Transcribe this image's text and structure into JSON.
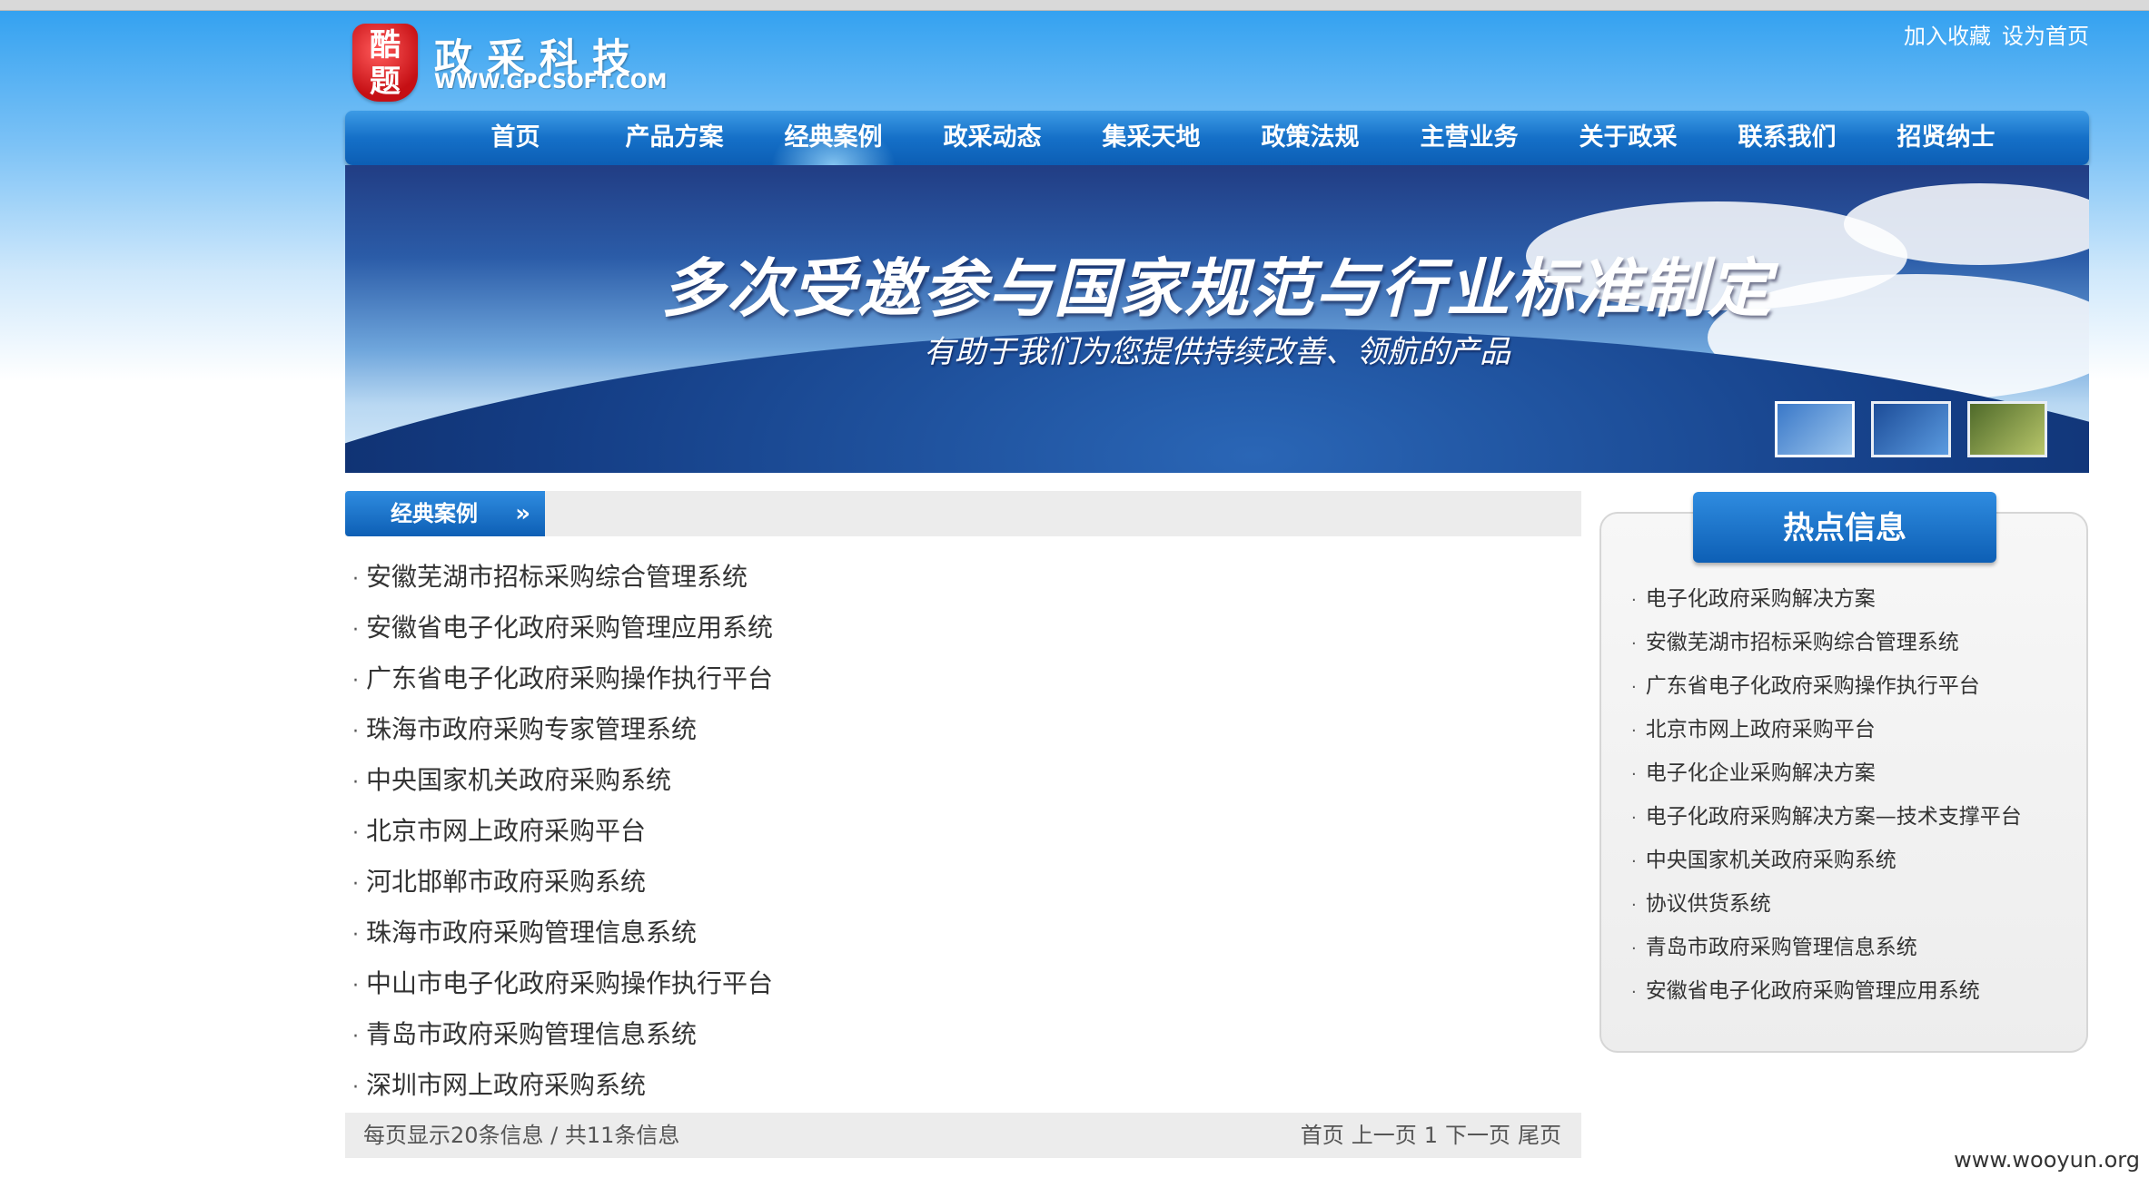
{
  "header": {
    "logo_seal_text": "酷\n题",
    "logo_name": "政采科技",
    "logo_url": "WWW.GPCSOFT.COM",
    "top_links": [
      "加入收藏",
      "设为首页"
    ]
  },
  "nav": {
    "items": [
      "首页",
      "产品方案",
      "经典案例",
      "政采动态",
      "集采天地",
      "政策法规",
      "主营业务",
      "关于政采",
      "联系我们",
      "招贤纳士"
    ],
    "active": "经典案例"
  },
  "banner": {
    "title": "多次受邀参与国家规范与行业标准制定",
    "subtitle": "有助于我们为您提供持续改善、领航的产品"
  },
  "section": {
    "tab_label": "经典案例",
    "tab_chevron": "»"
  },
  "cases": [
    "安徽芜湖市招标采购综合管理系统",
    "安徽省电子化政府采购管理应用系统",
    "广东省电子化政府采购操作执行平台",
    "珠海市政府采购专家管理系统",
    "中央国家机关政府采购系统",
    "北京市网上政府采购平台",
    "河北邯郸市政府采购系统",
    "珠海市政府采购管理信息系统",
    "中山市电子化政府采购操作执行平台",
    "青岛市政府采购管理信息系统",
    "深圳市网上政府采购系统"
  ],
  "pager": {
    "info": "每页显示20条信息 / 共11条信息",
    "first": "首页",
    "prev": "上一页",
    "current": "1",
    "next": "下一页",
    "last": "尾页"
  },
  "hot": {
    "title": "热点信息",
    "items": [
      "电子化政府采购解决方案",
      "安徽芜湖市招标采购综合管理系统",
      "广东省电子化政府采购操作执行平台",
      "北京市网上政府采购平台",
      "电子化企业采购解决方案",
      "电子化政府采购解决方案—技术支撑平台",
      "中央国家机关政府采购系统",
      "协议供货系统",
      "青岛市政府采购管理信息系统",
      "安徽省电子化政府采购管理应用系统"
    ]
  },
  "watermark": "www.wooyun.org"
}
